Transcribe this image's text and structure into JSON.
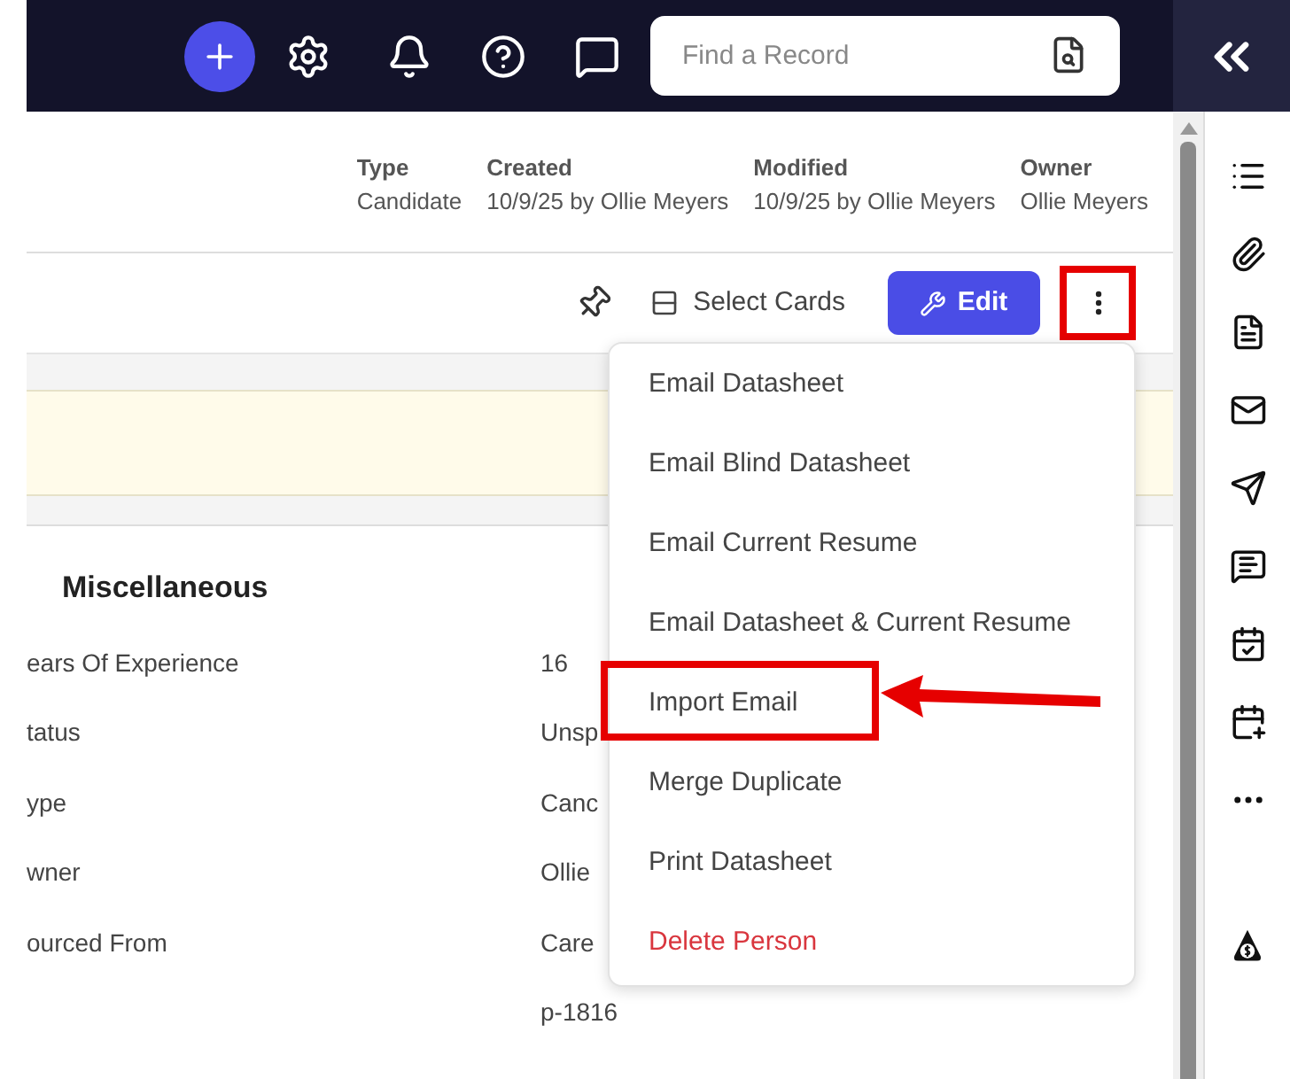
{
  "top_bar": {
    "search": {
      "placeholder": "Find a Record"
    }
  },
  "record_meta": [
    {
      "label": "Type",
      "value": "Candidate"
    },
    {
      "label": "Created",
      "value": "10/9/25 by Ollie Meyers"
    },
    {
      "label": "Modified",
      "value": "10/9/25 by Ollie Meyers"
    },
    {
      "label": "Owner",
      "value": "Ollie Meyers"
    }
  ],
  "toolbar": {
    "select_cards": "Select Cards",
    "edit": "Edit",
    "more_annotated": true
  },
  "section": {
    "title": "Miscellaneous",
    "rows": [
      {
        "label": "ears Of Experience",
        "value": "16"
      },
      {
        "label": "tatus",
        "value": "Unsp"
      },
      {
        "label": "ype",
        "value": "Canc"
      },
      {
        "label": "wner",
        "value": "Ollie"
      },
      {
        "label": "ourced From",
        "value": "Care"
      },
      {
        "value": "p-1816"
      }
    ]
  },
  "menu": [
    {
      "label": "Email Datasheet",
      "kind": "normal",
      "annotated": false
    },
    {
      "label": "Email Blind Datasheet",
      "kind": "normal",
      "annotated": false
    },
    {
      "label": "Email Current Resume",
      "kind": "normal",
      "annotated": false
    },
    {
      "label": "Email Datasheet & Current Resume",
      "kind": "normal",
      "annotated": false
    },
    {
      "label": "Import Email",
      "kind": "normal",
      "annotated": true
    },
    {
      "label": "Merge Duplicate",
      "kind": "normal",
      "annotated": false
    },
    {
      "label": "Print Datasheet",
      "kind": "normal",
      "annotated": false
    },
    {
      "label": "Delete Person",
      "kind": "danger",
      "annotated": false
    }
  ]
}
